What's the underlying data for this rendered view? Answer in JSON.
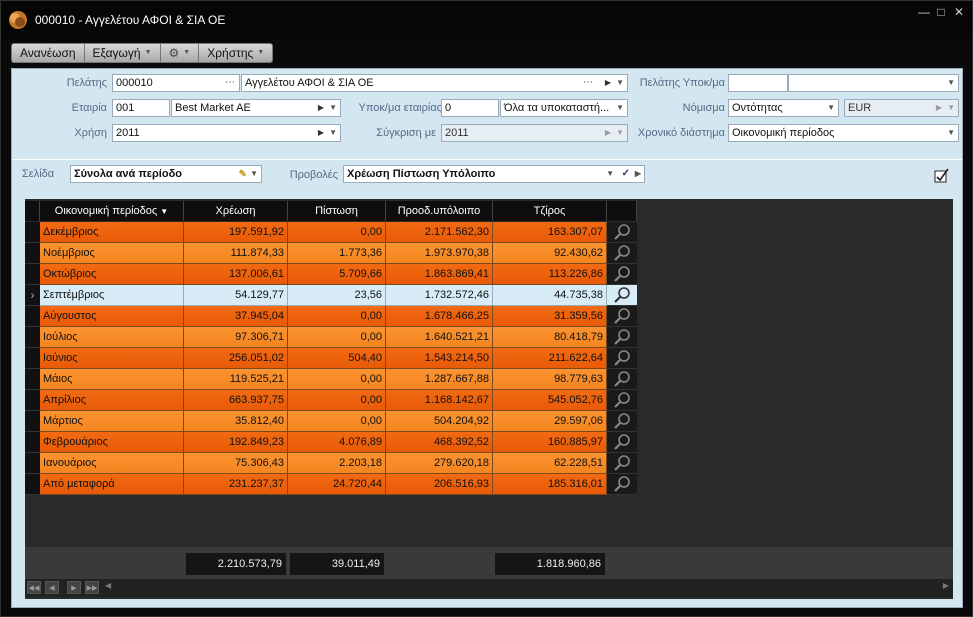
{
  "window": {
    "title": "000010 - Αγγελέτου ΑΦΟΙ & ΣΙΑ ΟΕ"
  },
  "toolbar": {
    "refresh": "Ανανέωση",
    "export": "Εξαγωγή",
    "users": "Χρήστης"
  },
  "form": {
    "customer_label": "Πελάτης",
    "customer_code": "000010",
    "customer_name": "Αγγελέτου ΑΦΟΙ & ΣΙΑ ΟΕ",
    "customer_branch_label": "Πελάτης Υποκ/μα",
    "customer_branch_value": "",
    "company_label": "Εταιρία",
    "company_code": "001",
    "company_name": "Best Market AE",
    "company_branch_label": "Υποκ/μα εταιρίας",
    "company_branch_code": "0",
    "company_branch_name": "Όλα τα υποκαταστή...",
    "currency_label": "Νόμισμα",
    "currency_value": "Οντότητας",
    "currency_code": "EUR",
    "fiscal_year_label": "Χρήση",
    "fiscal_year_value": "2011",
    "compare_label": "Σύγκριση με",
    "compare_value": "2011",
    "period_label": "Χρονικό διάστημα",
    "period_value": "Οικονομική περίοδος",
    "page_label": "Σελίδα",
    "page_value": "Σύνολα ανά περίοδο",
    "views_label": "Προβολές",
    "views_value": "Χρέωση Πίστωση Υπόλοιπο"
  },
  "grid": {
    "columns": [
      "Οικονομική περίοδος",
      "Χρέωση",
      "Πίστωση",
      "Προοδ.υπόλοιπο",
      "Τζίρος"
    ],
    "rows": [
      [
        "Δεκέμβριος",
        "197.591,92",
        "0,00",
        "2.171.562,30",
        "163.307,07"
      ],
      [
        "Νοέμβριος",
        "111.874,33",
        "1.773,36",
        "1.973.970,38",
        "92.430,62"
      ],
      [
        "Οκτώβριος",
        "137.006,61",
        "5.709,66",
        "1.863.869,41",
        "113.226,86"
      ],
      [
        "Σεπτέμβριος",
        "54.129,77",
        "23,56",
        "1.732.572,46",
        "44.735,38"
      ],
      [
        "Αύγουστος",
        "37.945,04",
        "0,00",
        "1.678.466,25",
        "31.359,56"
      ],
      [
        "Ιούλιος",
        "97.306,71",
        "0,00",
        "1.640.521,21",
        "80.418,79"
      ],
      [
        "Ιούνιος",
        "256.051,02",
        "504,40",
        "1.543.214,50",
        "211.622,64"
      ],
      [
        "Μάιος",
        "119.525,21",
        "0,00",
        "1.287.667,88",
        "98.779,63"
      ],
      [
        "Απρίλιος",
        "663.937,75",
        "0,00",
        "1.168.142,67",
        "545.052,76"
      ],
      [
        "Μάρτιος",
        "35.812,40",
        "0,00",
        "504.204,92",
        "29.597,06"
      ],
      [
        "Φεβρουάριος",
        "192.849,23",
        "4.076,89",
        "468.392,52",
        "160.885,97"
      ],
      [
        "Ιανουάριος",
        "75.306,43",
        "2.203,18",
        "279.620,18",
        "62.228,51"
      ],
      [
        "Από μεταφορά",
        "231.237,37",
        "24.720,44",
        "206.516,93",
        "185.316,01"
      ]
    ],
    "selected_row": 3,
    "totals": {
      "debit": "2.210.573,79",
      "credit": "39.011,49",
      "turnover": "1.818.960,86"
    }
  },
  "colors": {
    "row_orange": "#f26a12",
    "row_light": "#fb9330",
    "row_selected": "#d8ecf7"
  }
}
